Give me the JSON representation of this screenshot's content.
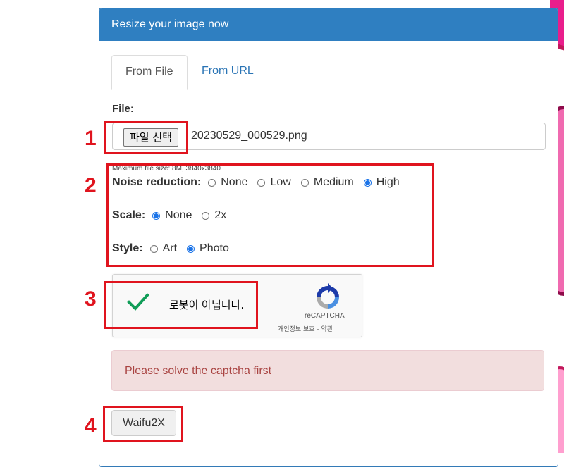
{
  "panel": {
    "title": "Resize your image now"
  },
  "tabs": [
    {
      "label": "From File",
      "active": true
    },
    {
      "label": "From URL",
      "active": false
    }
  ],
  "file": {
    "label": "File:",
    "button_label": "파일 선택",
    "file_name": "20230529_000529.png",
    "max_size_note": "Maximum file size: 8M, 3840x3840"
  },
  "options": {
    "noise": {
      "label": "Noise reduction:",
      "choices": [
        "None",
        "Low",
        "Medium",
        "High"
      ],
      "selected": "High"
    },
    "scale": {
      "label": "Scale:",
      "choices": [
        "None",
        "2x"
      ],
      "selected": "None"
    },
    "style": {
      "label": "Style:",
      "choices": [
        "Art",
        "Photo"
      ],
      "selected": "Photo"
    }
  },
  "captcha": {
    "text": "로봇이 아닙니다.",
    "brand": "reCAPTCHA",
    "links": "개인정보 보호 - 약관",
    "checked": true
  },
  "alert": {
    "message": "Please solve the captcha first"
  },
  "submit": {
    "label": "Waifu2X"
  },
  "annotations": [
    "1",
    "2",
    "3",
    "4"
  ],
  "colors": {
    "header_bg": "#2f7fc1",
    "link": "#2a74b5",
    "alert_bg": "#f2dede",
    "alert_text": "#a94442",
    "annotation": "#e0141e",
    "radio_selected": "#1a73e8",
    "check": "#109d58"
  }
}
